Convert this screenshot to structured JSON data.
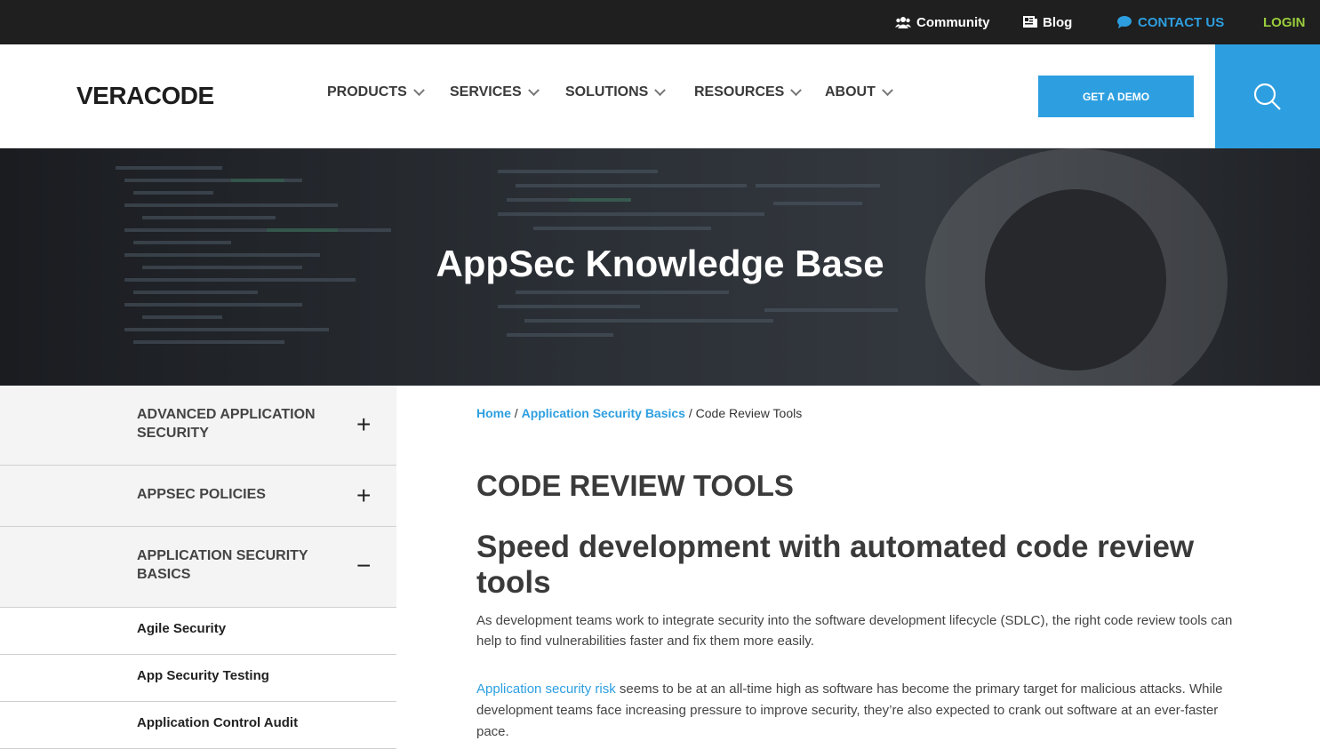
{
  "topbar": {
    "community": "Community",
    "blog": "Blog",
    "contact": "CONTACT US",
    "login": "LOGIN"
  },
  "nav": {
    "logo": "VERACODE",
    "items": [
      "PRODUCTS",
      "SERVICES",
      "SOLUTIONS",
      "RESOURCES",
      "ABOUT"
    ],
    "demo": "GET A DEMO"
  },
  "hero": {
    "title": "AppSec Knowledge Base"
  },
  "sidebar": {
    "sections": [
      {
        "label": "ADVANCED APPLICATION SECURITY",
        "toggle": "+"
      },
      {
        "label": "APPSEC POLICIES",
        "toggle": "+"
      },
      {
        "label": "APPLICATION SECURITY BASICS",
        "toggle": "−"
      }
    ],
    "subitems": [
      "Agile Security",
      "App Security Testing",
      "Application Control Audit"
    ]
  },
  "breadcrumb": {
    "home": "Home",
    "section": "Application Security Basics",
    "sep1": " / ",
    "sep2": " / ",
    "current": "Code Review Tools"
  },
  "content": {
    "title": "CODE REVIEW TOOLS",
    "subtitle": "Speed development with automated code review tools",
    "para1": "As development teams work to integrate security into the software development lifecycle (SDLC), the right code review tools can help to find vulnerabilities faster and fix them more easily.",
    "para2_link": "Application security risk",
    "para2_rest": " seems to be at an all-time high as software has become the primary target for malicious attacks. While development teams face increasing pressure to improve security, they’re also expected to crank out software at an ever-faster pace."
  },
  "colors": {
    "accent": "#2d9fe0",
    "login": "#9acd3c",
    "topbar": "#1f1f1f"
  }
}
